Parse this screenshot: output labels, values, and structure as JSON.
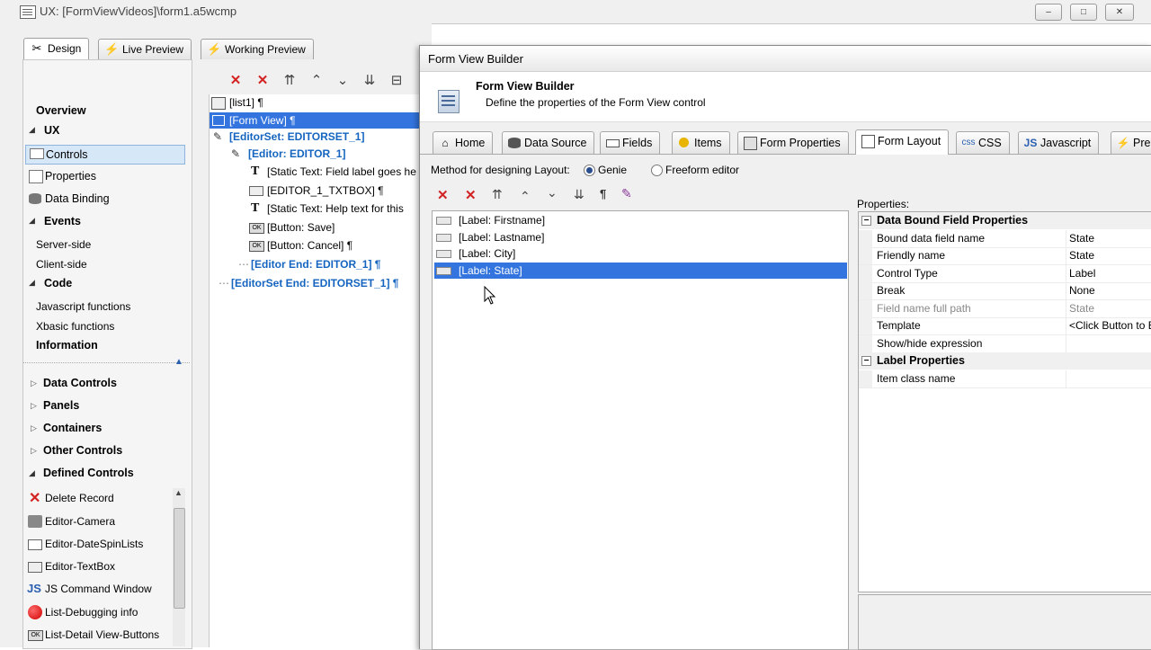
{
  "window": {
    "title": "UX: [FormViewVideos]\\form1.a5wcmp",
    "controls": {
      "minimize": "–",
      "maximize": "□",
      "close": "✕"
    }
  },
  "mode_tabs": [
    {
      "label": "Design",
      "icon": "design-tools-icon"
    },
    {
      "label": "Live Preview",
      "icon": "lightning-icon"
    },
    {
      "label": "Working Preview",
      "icon": "lightning-icon"
    }
  ],
  "nav": {
    "overview": "Overview",
    "ux": "UX",
    "controls": "Controls",
    "properties": "Properties",
    "data_binding": "Data Binding",
    "events": "Events",
    "server_side": "Server-side",
    "client_side": "Client-side",
    "code": "Code",
    "js_functions": "Javascript functions",
    "xbasic_functions": "Xbasic functions",
    "information": "Information",
    "groups": [
      "Data Controls",
      "Panels",
      "Containers",
      "Other Controls",
      "Defined Controls"
    ],
    "defined": [
      {
        "label": "Delete Record",
        "icon": "delete-x-icon"
      },
      {
        "label": "Editor-Camera",
        "icon": "camera-icon"
      },
      {
        "label": "Editor-DateSpinLists",
        "icon": "list-icon"
      },
      {
        "label": "Editor-TextBox",
        "icon": "textbox-icon"
      },
      {
        "label": "JS Command Window",
        "icon": "js-icon"
      },
      {
        "label": "List-Debugging info",
        "icon": "red-circle-icon"
      },
      {
        "label": "List-Detail View-Buttons",
        "icon": "ok-button-icon"
      }
    ]
  },
  "tree": {
    "items": [
      "[list1] ¶",
      "[Form View] ¶",
      "[EditorSet: EDITORSET_1]",
      "[Editor: EDITOR_1]",
      "[Static Text: Field label goes he",
      "[EDITOR_1_TXTBOX] ¶",
      "[Static Text: Help text for this",
      "[Button: Save]",
      "[Button: Cancel] ¶",
      "[Editor End: EDITOR_1] ¶",
      "[EditorSet End: EDITORSET_1] ¶"
    ]
  },
  "dialog": {
    "title": "Form View Builder",
    "header_title": "Form View Builder",
    "header_desc": "Define the properties of the Form View control",
    "tabs": [
      {
        "label": "Home",
        "icon": "home-icon"
      },
      {
        "label": "Data Source",
        "icon": "database-icon"
      },
      {
        "label": "Fields",
        "icon": "fields-icon"
      },
      {
        "label": "Items",
        "icon": "items-icon"
      },
      {
        "label": "Form Properties",
        "icon": "form-icon"
      },
      {
        "label": "Form Layout",
        "icon": "layout-icon"
      },
      {
        "label": "CSS",
        "icon": "css-icon",
        "prefix": "css"
      },
      {
        "label": "Javascript",
        "icon": "js-icon",
        "prefix": "JS"
      },
      {
        "label": "Pre",
        "icon": "lightning-icon"
      }
    ],
    "active_tab": "Form Layout",
    "method_label": "Method for designing Layout:",
    "method_options": [
      "Genie",
      "Freeform editor"
    ],
    "method_selected": "Genie",
    "layout_items": [
      "[Label: Firstname]",
      "[Label: Lastname]",
      "[Label: City]",
      "[Label: State]"
    ],
    "selected_item": "[Label: State]",
    "properties_label": "Properties:",
    "properties": {
      "cat1": "Data Bound Field Properties",
      "rows1": [
        {
          "name": "Bound data field name",
          "value": "State"
        },
        {
          "name": "Friendly name",
          "value": "State"
        },
        {
          "name": "Control Type",
          "value": "Label"
        },
        {
          "name": "Break",
          "value": "None"
        },
        {
          "name": "Field name full path",
          "value": "State"
        },
        {
          "name": "Template",
          "value": "<Click Button to E"
        },
        {
          "name": "Show/hide expression",
          "value": ""
        }
      ],
      "cat2": "Label Properties",
      "rows2": [
        {
          "name": "Item class name",
          "value": ""
        }
      ]
    }
  }
}
